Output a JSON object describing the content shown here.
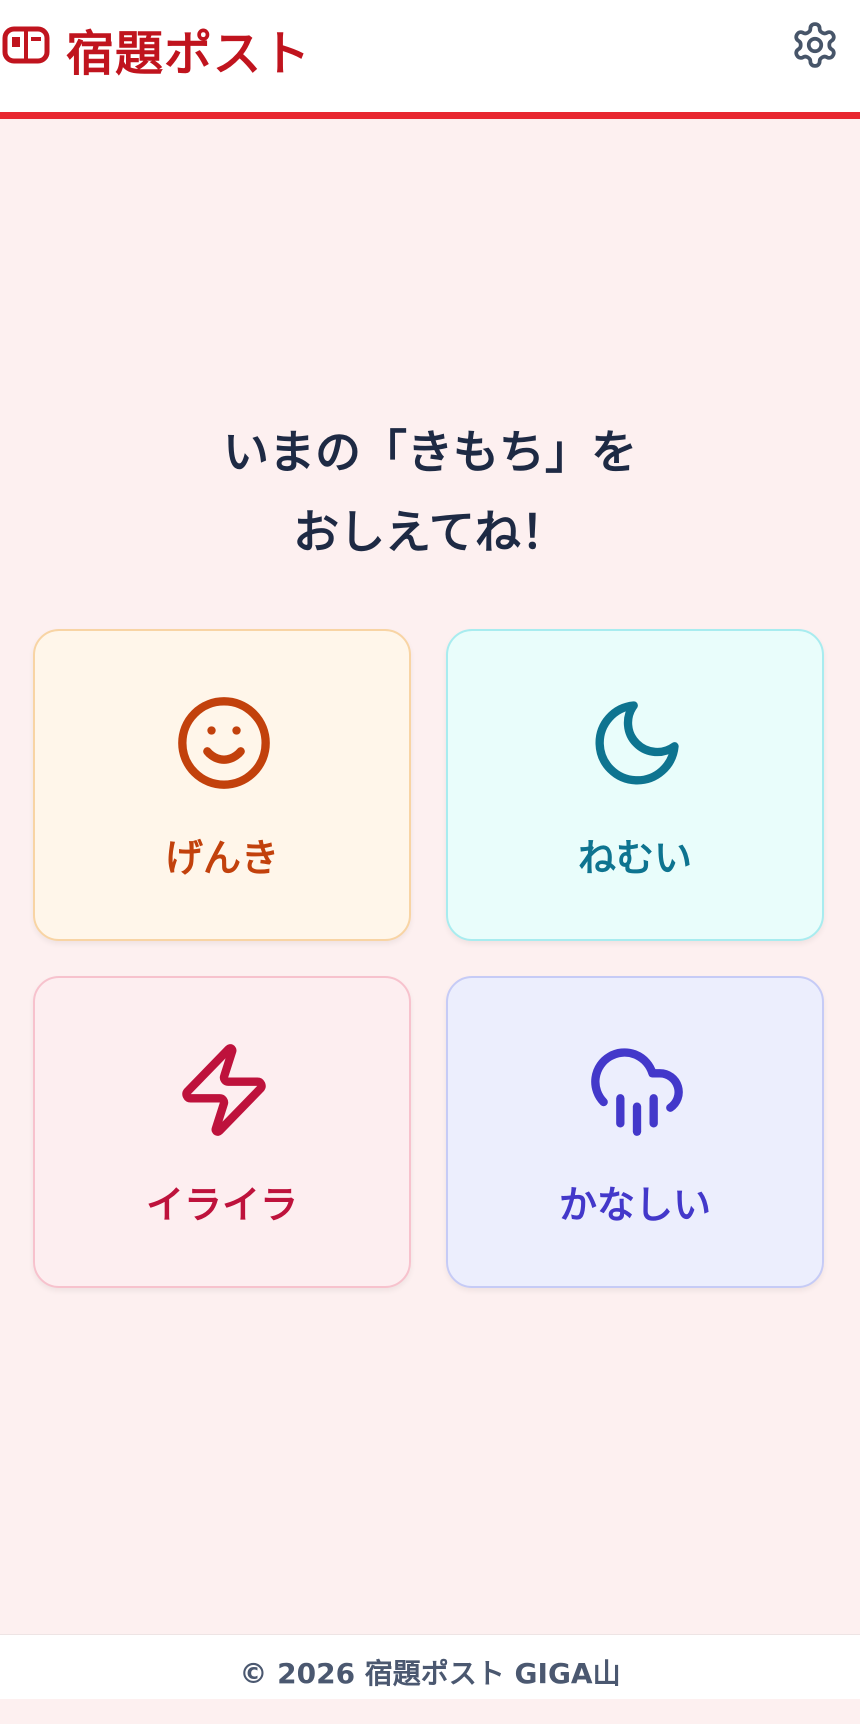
{
  "header": {
    "app_title": "宿題ポスト",
    "logo_icon": "mailbox-icon",
    "settings_icon": "gear-icon",
    "accent_color": "#e8262f",
    "title_color": "#c0141e"
  },
  "main": {
    "question_line1": "いまの「きもち」を",
    "question_line2": "おしえてね！",
    "moods": [
      {
        "label": "げんき",
        "icon": "smile-icon",
        "color": "#c2410c"
      },
      {
        "label": "ねむい",
        "icon": "moon-icon",
        "color": "#0e7490"
      },
      {
        "label": "イライラ",
        "icon": "lightning-icon",
        "color": "#be123c"
      },
      {
        "label": "かなしい",
        "icon": "rain-cloud-icon",
        "color": "#4338ca"
      }
    ]
  },
  "footer": {
    "copyright": "© 2026 宿題ポスト GIGA山"
  }
}
